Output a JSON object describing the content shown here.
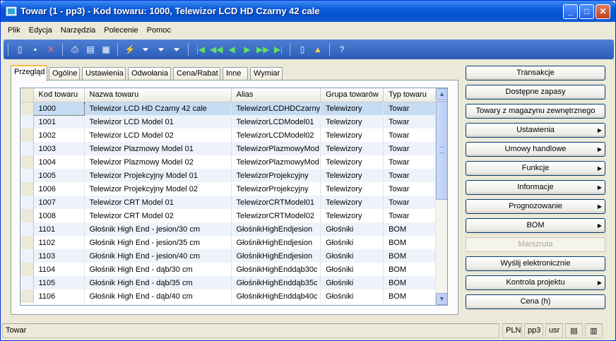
{
  "window": {
    "title": "Towar (1 - pp3) - Kod towaru: 1000, Telewizor LCD HD Czarny 42 cale"
  },
  "menu": [
    "Plik",
    "Edycja",
    "Narzędzia",
    "Polecenie",
    "Pomoc"
  ],
  "toolbar_icons": [
    "new-icon",
    "save-icon",
    "delete-icon",
    "print-icon",
    "print-preview-icon",
    "export-icon",
    "filter-by-selection-icon",
    "filter-by-form-icon",
    "advanced-filter-icon",
    "remove-filter-icon",
    "first-record-icon",
    "previous-page-icon",
    "previous-record-icon",
    "next-record-icon",
    "next-page-icon",
    "last-record-icon",
    "notes-icon",
    "alert-icon",
    "help-icon"
  ],
  "tabs": [
    "Przegląd",
    "Ogólne",
    "Ustawienia",
    "Odwołania",
    "Cena/Rabat",
    "Inne",
    "Wymiar"
  ],
  "grid": {
    "columns": [
      "Kod towaru",
      "Nazwa towaru",
      "Alias",
      "Grupa towarów",
      "Typ towaru"
    ],
    "rows": [
      [
        "1000",
        "Telewizor LCD HD Czarny 42 cale",
        "TelewizorLCDHDCzarny",
        "Telewizory",
        "Towar"
      ],
      [
        "1001",
        "Telewizor LCD Model 01",
        "TelewizorLCDModel01",
        "Telewizory",
        "Towar"
      ],
      [
        "1002",
        "Telewizor LCD Model 02",
        "TelewizorLCDModel02",
        "Telewizory",
        "Towar"
      ],
      [
        "1003",
        "Telewizor Plazmowy Model 01",
        "TelewizorPlazmowyMod",
        "Telewizory",
        "Towar"
      ],
      [
        "1004",
        "Telewizor Plazmowy Model 02",
        "TelewizorPlazmowyMod",
        "Telewizory",
        "Towar"
      ],
      [
        "1005",
        "Telewizor Projekcyjny Model 01",
        "TelewizorProjekcyjny",
        "Telewizory",
        "Towar"
      ],
      [
        "1006",
        "Telewizor Projekcyjny Model 02",
        "TelewizorProjekcyjny",
        "Telewizory",
        "Towar"
      ],
      [
        "1007",
        "Telewizor CRT Model 01",
        "TelewizorCRTModel01",
        "Telewizory",
        "Towar"
      ],
      [
        "1008",
        "Telewizor CRT Model 02",
        "TelewizorCRTModel02",
        "Telewizory",
        "Towar"
      ],
      [
        "1101",
        "Głośnik High End - jesion/30 cm",
        "GłośnikHighEndjesion",
        "Głośniki",
        "BOM"
      ],
      [
        "1102",
        "Głośnik High End - jesion/35 cm",
        "GłośnikHighEndjesion",
        "Głośniki",
        "BOM"
      ],
      [
        "1103",
        "Głośnik High End - jesion/40 cm",
        "GłośnikHighEndjesion",
        "Głośniki",
        "BOM"
      ],
      [
        "1104",
        "Głośnik High End - dąb/30 cm",
        "GłośnikHighEnddąb30c",
        "Głośniki",
        "BOM"
      ],
      [
        "1105",
        "Głośnik High End - dąb/35 cm",
        "GłośnikHighEnddąb35c",
        "Głośniki",
        "BOM"
      ],
      [
        "1106",
        "Głośnik High End - dąb/40 cm",
        "GłośnikHighEnddąb40c",
        "Głośniki",
        "BOM"
      ]
    ]
  },
  "side_buttons": [
    {
      "label": "Transakcje",
      "submenu": false,
      "enabled": true
    },
    {
      "label": "Dostępne zapasy",
      "submenu": false,
      "enabled": true
    },
    {
      "label": "Towary z magazynu zewnętrznego",
      "submenu": false,
      "enabled": true
    },
    {
      "label": "Ustawienia",
      "submenu": true,
      "enabled": true
    },
    {
      "label": "Umowy handlowe",
      "submenu": true,
      "enabled": true
    },
    {
      "label": "Funkcje",
      "submenu": true,
      "enabled": true
    },
    {
      "label": "Informacje",
      "submenu": true,
      "enabled": true
    },
    {
      "label": "Prognozowanie",
      "submenu": true,
      "enabled": true
    },
    {
      "label": "BOM",
      "submenu": true,
      "enabled": true
    },
    {
      "label": "Marszruta",
      "submenu": false,
      "enabled": false
    },
    {
      "label": "Wyślij elektronicznie",
      "submenu": false,
      "enabled": true
    },
    {
      "label": "Kontrola projektu",
      "submenu": true,
      "enabled": true
    },
    {
      "label": "Cena (h)",
      "submenu": false,
      "enabled": true
    }
  ],
  "status": {
    "text": "Towar",
    "currency": "PLN",
    "company": "pp3",
    "user": "usr"
  }
}
